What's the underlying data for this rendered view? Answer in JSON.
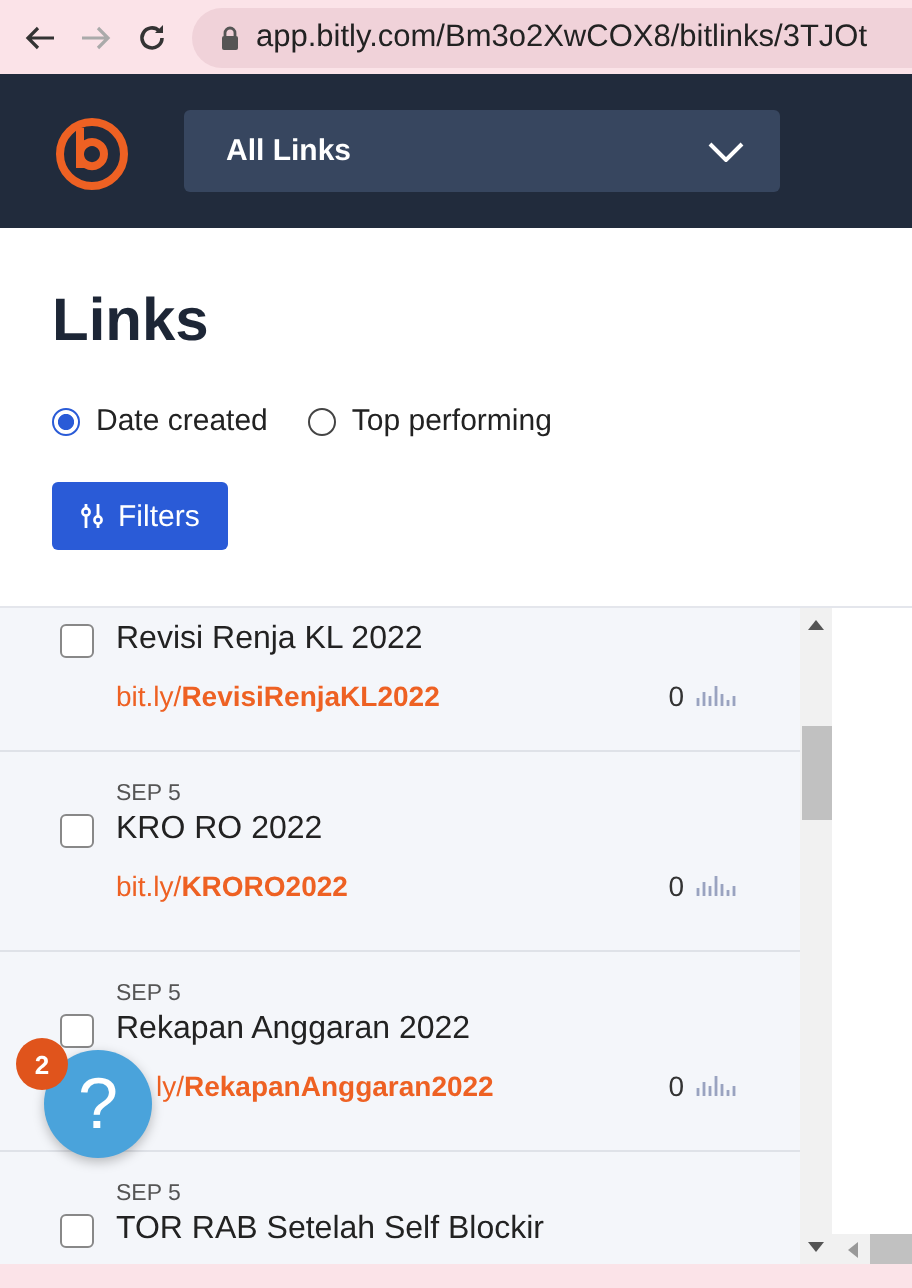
{
  "browser": {
    "url": "app.bitly.com/Bm3o2XwCOX8/bitlinks/3TJOt"
  },
  "header": {
    "dropdown": "All Links"
  },
  "page": {
    "title": "Links"
  },
  "sort_options": [
    {
      "label": "Date created",
      "selected": true
    },
    {
      "label": "Top performing",
      "selected": false
    }
  ],
  "filters_button": "Filters",
  "links": [
    {
      "title": "Revisi Renja KL 2022",
      "prefix": "bit.ly/",
      "slug": "RevisiRenjaKL2022",
      "clicks": "0",
      "checked": false
    },
    {
      "date": "SEP 5",
      "title": "KRO RO 2022",
      "prefix": "bit.ly/",
      "slug": "KRORO2022",
      "clicks": "0",
      "checked": false
    },
    {
      "date": "SEP 5",
      "title": "Rekapan Anggaran 2022",
      "prefix": "ly/",
      "slug": "RekapanAnggaran2022",
      "clicks": "0",
      "checked": false,
      "partly_hidden": true
    },
    {
      "date": "SEP 5",
      "title": "TOR RAB Setelah Self Blockir",
      "checked": false
    }
  ],
  "help": {
    "badge": "2",
    "icon": "?"
  }
}
